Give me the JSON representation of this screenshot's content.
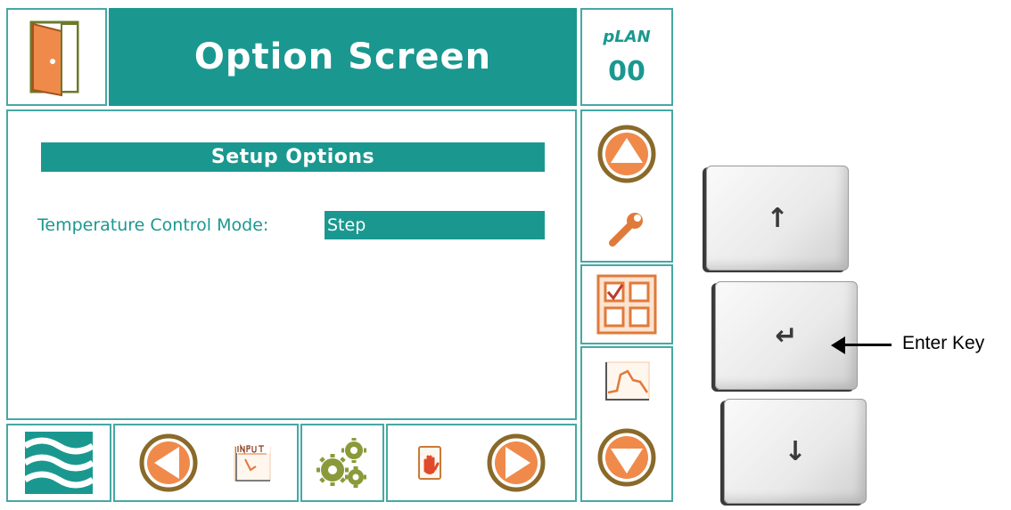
{
  "header": {
    "title": "Option Screen",
    "plan_label": "pLAN",
    "plan_value": "00"
  },
  "content": {
    "section_title": "Setup Options",
    "fields": [
      {
        "label": "Temperature Control Mode:",
        "value": "Step"
      }
    ]
  },
  "icons": {
    "exit": "door-icon",
    "up": "up-arrow-icon",
    "tools": "wrench-icon",
    "menu": "checklist-grid-icon",
    "graph": "graph-icon",
    "down": "down-arrow-icon",
    "logo": "waves-logo-icon",
    "prev": "left-arrow-icon",
    "input": "input-icon",
    "settings": "gears-icon",
    "alarm": "hand-alarm-icon",
    "next": "right-arrow-icon"
  },
  "keypad": {
    "up_glyph": "↑",
    "enter_glyph": "↵",
    "down_glyph": "↓",
    "callout": "Enter Key"
  },
  "colors": {
    "teal": "#1a9890",
    "border": "#46a8a4",
    "orange": "#f08a4b",
    "olive_ring": "#8a6a2a"
  }
}
